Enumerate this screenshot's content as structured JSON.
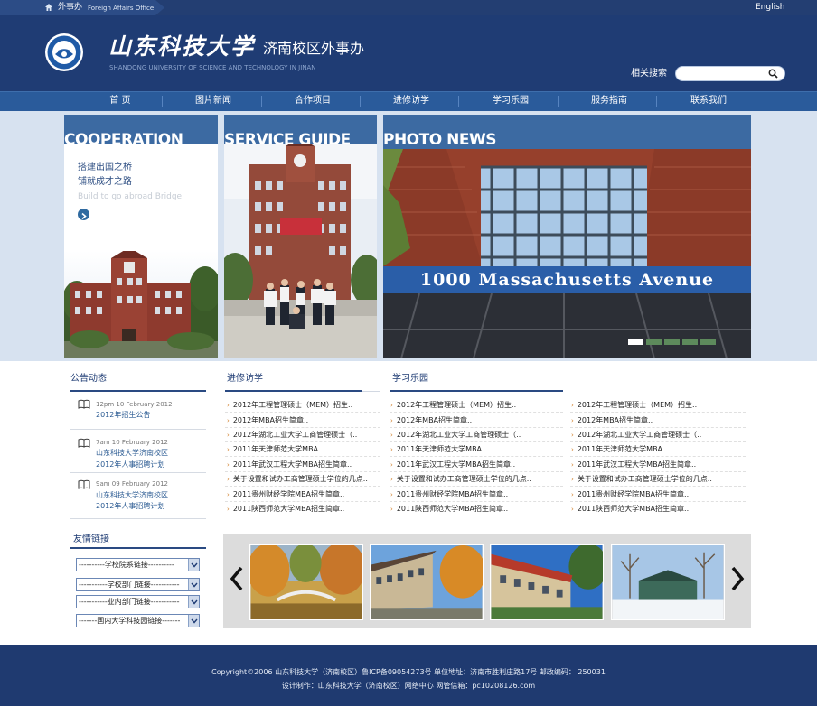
{
  "topbar": {
    "home_label": "外事办",
    "office_en": "Foreign Affairs Office",
    "language_link": "English"
  },
  "header": {
    "school_name_calligraphy": "山东科技大学",
    "campus_office": "济南校区外事办",
    "school_name_en": "SHANDONG UNIVERSITY OF SCIENCE AND TECHNOLOGY IN JINAN",
    "search_label": "相关搜索",
    "search_value": ""
  },
  "nav": [
    "首 页",
    "图片新闻",
    "合作项目",
    "进修访学",
    "学习乐园",
    "服务指南",
    "联系我们"
  ],
  "banner": {
    "cooperation": {
      "title": "COOPERATION",
      "line1": "搭建出国之桥",
      "line2": "铺就成才之路",
      "line3": "Build to go abroad Bridge"
    },
    "service_title": "SERVICE GUIDE",
    "photo_title": "PHOTO NEWS",
    "photo_sign": "1000 Massachusetts Avenue"
  },
  "announcements": {
    "title": "公告动态",
    "items": [
      {
        "date": "12pm 10 February 2012",
        "lines": [
          "2012年招生公告"
        ]
      },
      {
        "date": "7am 10 February 2012",
        "lines": [
          "山东科技大学济南校区",
          "2012年人事招聘计划"
        ]
      },
      {
        "date": "9am 09 February 2012",
        "lines": [
          "山东科技大学济南校区",
          "2012年人事招聘计划"
        ]
      }
    ]
  },
  "links": {
    "title": "友情链接",
    "selects": [
      "----------学校院系链接----------",
      "-----------学校部门链接-----------",
      "-----------业内部门链接-----------",
      "-------国内大学科技园链接-------"
    ]
  },
  "study_visit": {
    "title": "进修访学",
    "items": [
      "2012年工程管理硕士（MEM）招生..",
      "2012年MBA招生简章..",
      "2012年湖北工业大学工商管理硕士（..",
      "2011年天津师范大学MBA..",
      "2011年武汉工程大学MBA招生简章..",
      "关于设置和试办工商管理硕士学位的几点..",
      "2011贵州财经学院MBA招生简章..",
      "2011陕西师范大学MBA招生简章.."
    ]
  },
  "study_park": {
    "title": "学习乐园",
    "items": [
      "2012年工程管理硕士（MEM）招生..",
      "2012年MBA招生简章..",
      "2012年湖北工业大学工商管理硕士（..",
      "2011年天津师范大学MBA..",
      "2011年武汉工程大学MBA招生简章..",
      "关于设置和试办工商管理硕士学位的几点..",
      "2011贵州财经学院MBA招生简章..",
      "2011陕西师范大学MBA招生简章.."
    ]
  },
  "third_list": {
    "items": [
      "2012年工程管理硕士（MEM）招生..",
      "2012年MBA招生简章..",
      "2012年湖北工业大学工商管理硕士（..",
      "2011年天津师范大学MBA..",
      "2011年武汉工程大学MBA招生简章..",
      "关于设置和试办工商管理硕士学位的几点..",
      "2011贵州财经学院MBA招生简章..",
      "2011陕西师范大学MBA招生简章.."
    ]
  },
  "footer": {
    "line1": "Copyright©2006 山东科技大学（济南校区）鲁ICP备09054273号   单位地址：济南市胜利庄路17号  邮政编码： 250031",
    "line2": "设计制作：山东科技大学（济南校区）网络中心   网管信箱：pc10208126.com"
  },
  "colors": {
    "brand_navy": "#1f3c74",
    "nav_blue": "#2a5b9b",
    "panel_blue": "#3c6aa2",
    "accent_orange": "#d07a20"
  }
}
